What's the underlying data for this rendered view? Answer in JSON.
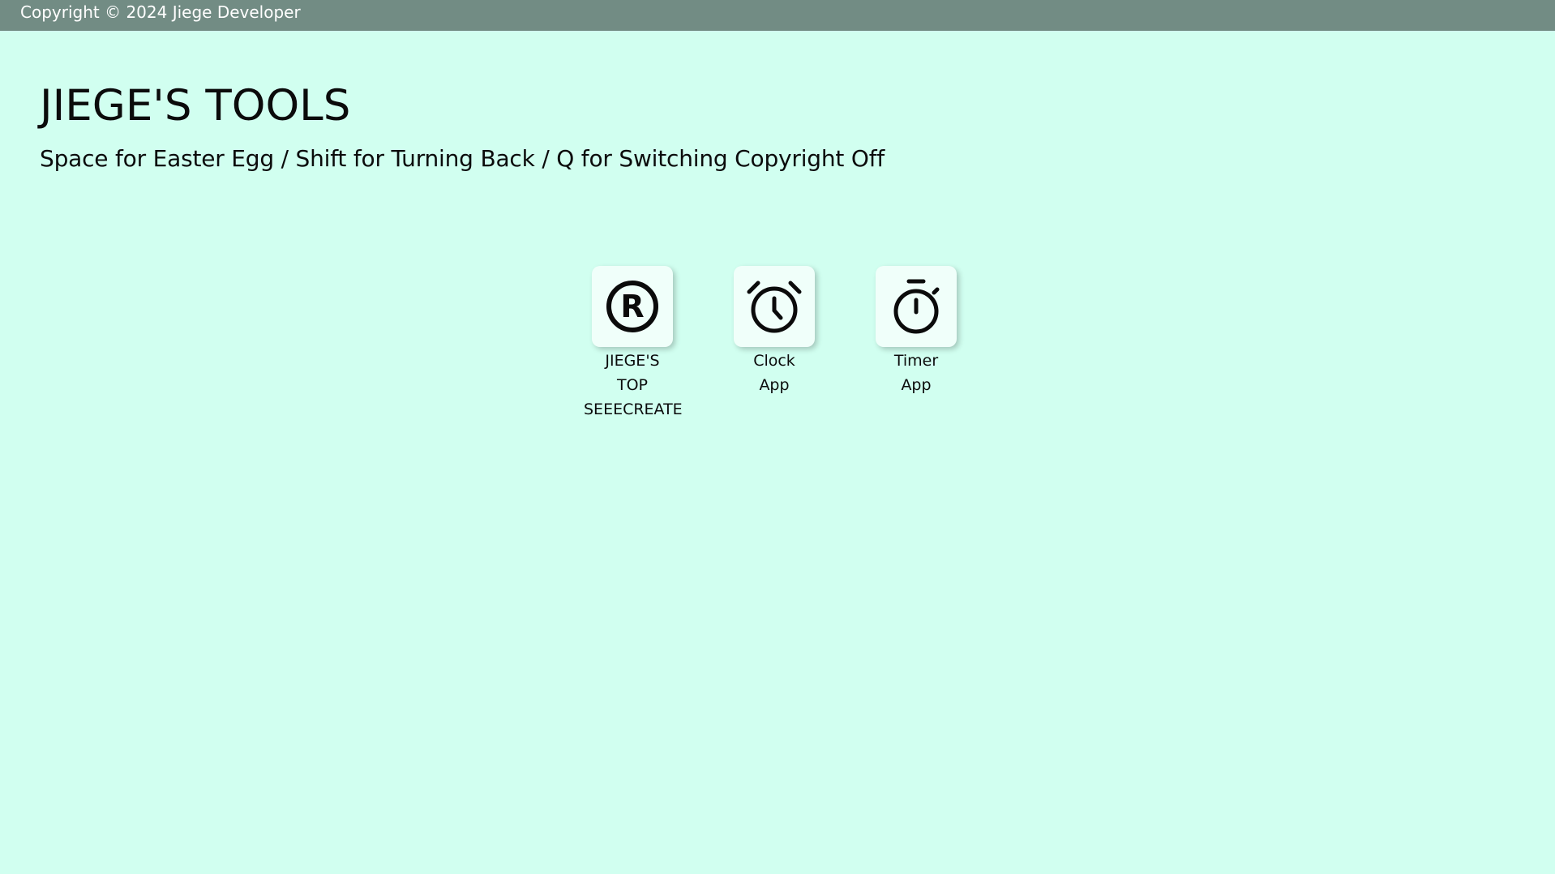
{
  "footer": {
    "copyright": "Copyright © 2024 Jiege Developer"
  },
  "header": {
    "title": "JIEGE'S TOOLS",
    "subtitle": "Space for Easter Egg / Shift for Turning Back / Q for Switching Copyright Off"
  },
  "apps": [
    {
      "label": "JIEGE'S TOP SEEECREATE",
      "icon": "registered-icon"
    },
    {
      "label": "Clock App",
      "icon": "alarm-clock-icon"
    },
    {
      "label": "Timer App",
      "icon": "stopwatch-icon"
    }
  ],
  "colors": {
    "background": "#d1fff0",
    "copyright_bar": "#728c84",
    "tile_background": "#f0fffa"
  }
}
